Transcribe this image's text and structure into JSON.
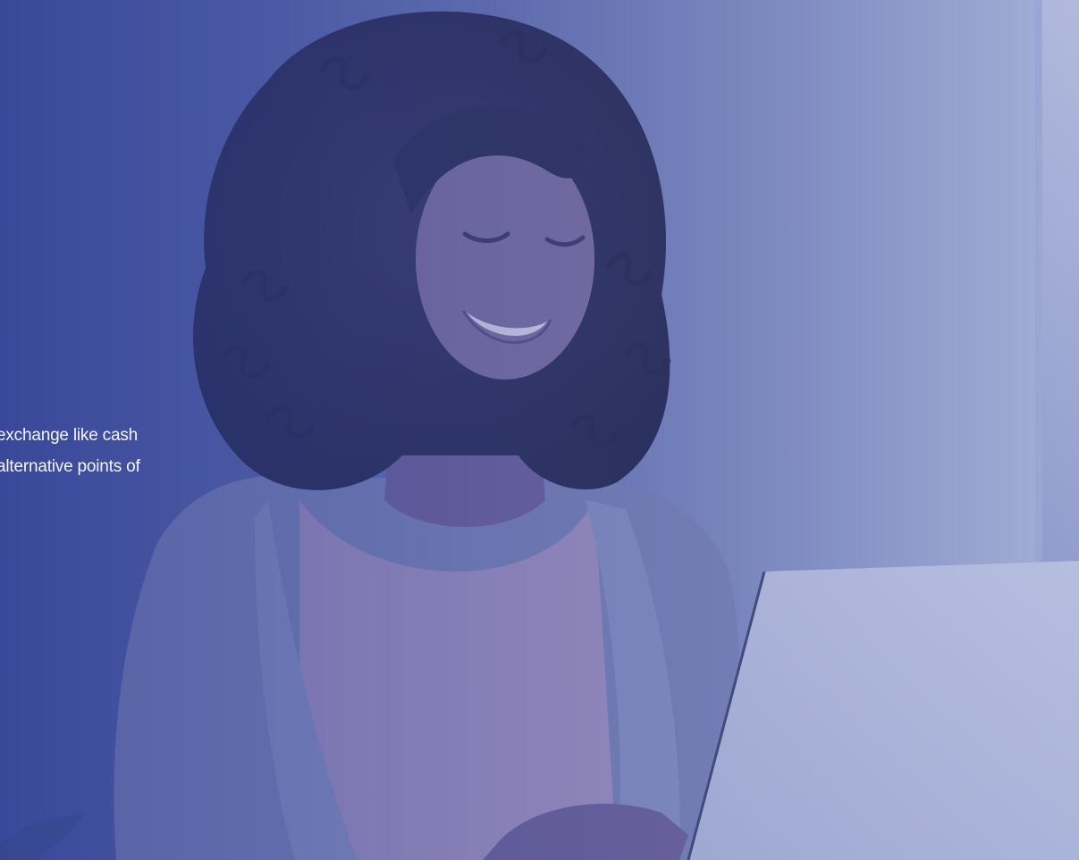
{
  "hero": {
    "text_lines": [
      "exchange like cash",
      "alternative points of"
    ],
    "overlay_color": "#3f4f9c"
  }
}
